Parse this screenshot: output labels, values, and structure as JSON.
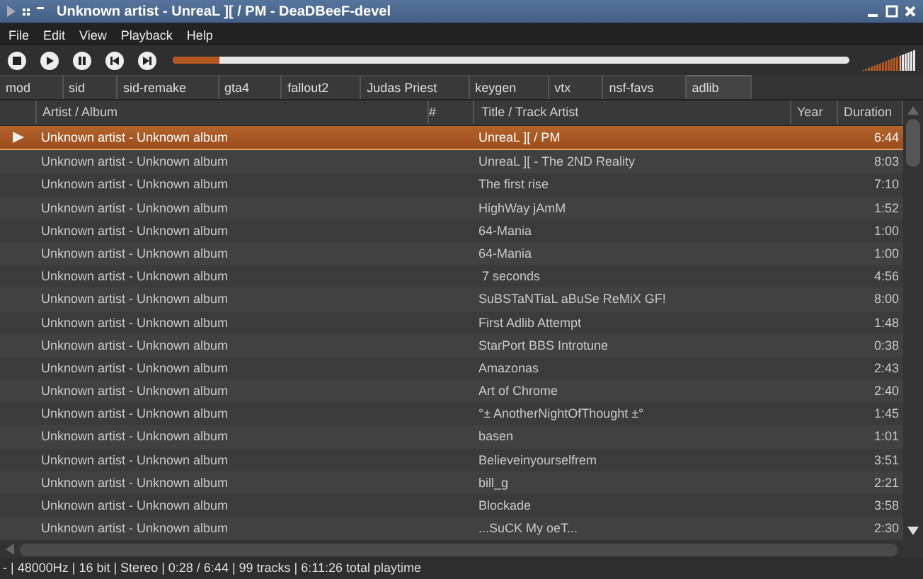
{
  "window": {
    "title": "Unknown artist - UnreaL ][ / PM  - DeaDBeeF-devel"
  },
  "menu": [
    "File",
    "Edit",
    "View",
    "Playback",
    "Help"
  ],
  "seekbar": {
    "level": 0.07
  },
  "volume": {
    "level": 0.7
  },
  "tabs": [
    {
      "label": "mod",
      "selected": false
    },
    {
      "label": "sid",
      "selected": false
    },
    {
      "label": "sid-remake",
      "selected": false
    },
    {
      "label": "gta4",
      "selected": false
    },
    {
      "label": "fallout2",
      "selected": false
    },
    {
      "label": "Judas Priest",
      "selected": false
    },
    {
      "label": "keygen",
      "selected": false
    },
    {
      "label": "vtx",
      "selected": false
    },
    {
      "label": "nsf-favs",
      "selected": false
    },
    {
      "label": "adlib",
      "selected": true
    }
  ],
  "table": {
    "columns": [
      "Artist / Album",
      "#",
      "Title / Track Artist",
      "Year",
      "Duration"
    ],
    "rows": [
      {
        "album": "Unknown artist - Unknown album",
        "title": "UnreaL ][ / PM",
        "duration": "6:44",
        "playing": true,
        "selected": true
      },
      {
        "album": "Unknown artist - Unknown album",
        "title": "UnreaL ][ - The 2ND Reality",
        "duration": "8:03",
        "playing": false,
        "selected": false
      },
      {
        "album": "Unknown artist - Unknown album",
        "title": "The first rise",
        "duration": "7:10",
        "playing": false,
        "selected": false
      },
      {
        "album": "Unknown artist - Unknown album",
        "title": "HighWay jAmM",
        "duration": "1:52",
        "playing": false,
        "selected": false
      },
      {
        "album": "Unknown artist - Unknown album",
        "title": "64-Mania",
        "duration": "1:00",
        "playing": false,
        "selected": false
      },
      {
        "album": "Unknown artist - Unknown album",
        "title": "64-Mania",
        "duration": "1:00",
        "playing": false,
        "selected": false
      },
      {
        "album": "Unknown artist - Unknown album",
        "title": " 7 seconds",
        "duration": "4:56",
        "playing": false,
        "selected": false
      },
      {
        "album": "Unknown artist - Unknown album",
        "title": "SuBSTaNTiaL aBuSe ReMiX GF!",
        "duration": "8:00",
        "playing": false,
        "selected": false
      },
      {
        "album": "Unknown artist - Unknown album",
        "title": "First Adlib Attempt",
        "duration": "1:48",
        "playing": false,
        "selected": false
      },
      {
        "album": "Unknown artist - Unknown album",
        "title": "StarPort BBS Introtune",
        "duration": "0:38",
        "playing": false,
        "selected": false
      },
      {
        "album": "Unknown artist - Unknown album",
        "title": "Amazonas",
        "duration": "2:43",
        "playing": false,
        "selected": false
      },
      {
        "album": "Unknown artist - Unknown album",
        "title": "Art of Chrome",
        "duration": "2:40",
        "playing": false,
        "selected": false
      },
      {
        "album": "Unknown artist - Unknown album",
        "title": "°± AnotherNightOfThought ±°",
        "duration": "1:45",
        "playing": false,
        "selected": false
      },
      {
        "album": "Unknown artist - Unknown album",
        "title": "basen",
        "duration": "1:01",
        "playing": false,
        "selected": false
      },
      {
        "album": "Unknown artist - Unknown album",
        "title": "Believeinyourselfrem",
        "duration": "3:51",
        "playing": false,
        "selected": false
      },
      {
        "album": "Unknown artist - Unknown album",
        "title": "bill_g",
        "duration": "2:21",
        "playing": false,
        "selected": false
      },
      {
        "album": "Unknown artist - Unknown album",
        "title": "Blockade",
        "duration": "3:58",
        "playing": false,
        "selected": false
      },
      {
        "album": "Unknown artist - Unknown album",
        "title": "...SuCK My oeT...",
        "duration": "2:30",
        "playing": false,
        "selected": false
      }
    ]
  },
  "status_bar": "- | 48000Hz | 16 bit | Stereo | 0:28 / 6:44 | 99 tracks | 6:11:26 total playtime"
}
